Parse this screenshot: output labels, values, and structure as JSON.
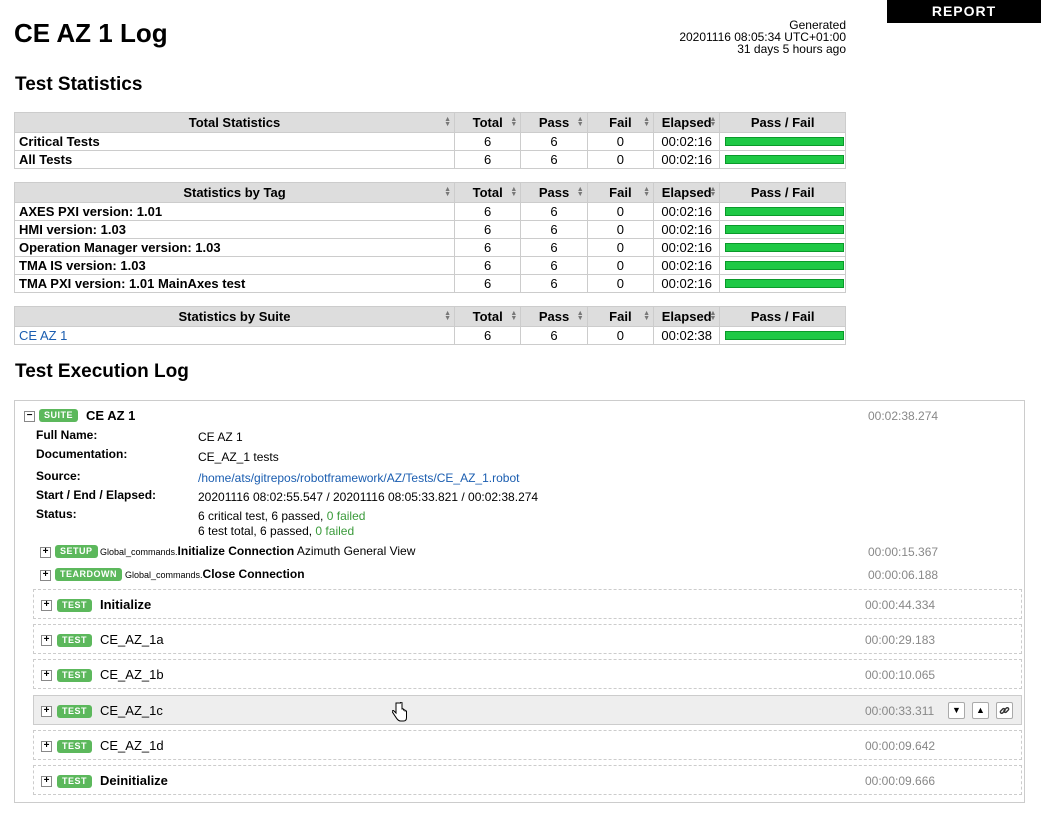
{
  "title": "CE AZ 1 Log",
  "generated": {
    "label": "Generated",
    "timestamp": "20201116 08:05:34 UTC+01:00",
    "ago": "31 days 5 hours ago"
  },
  "report_button": "REPORT",
  "statistics_heading": "Test Statistics",
  "columns": [
    "Total",
    "Pass",
    "Fail",
    "Elapsed",
    "Pass / Fail"
  ],
  "total_stats": {
    "header": "Total Statistics",
    "rows": [
      {
        "name": "Critical Tests",
        "total": "6",
        "pass": "6",
        "fail": "0",
        "elapsed": "00:02:16",
        "pass_ratio": 1.0
      },
      {
        "name": "All Tests",
        "total": "6",
        "pass": "6",
        "fail": "0",
        "elapsed": "00:02:16",
        "pass_ratio": 1.0
      }
    ]
  },
  "tag_stats": {
    "header": "Statistics by Tag",
    "rows": [
      {
        "name": "AXES PXI version: 1.01",
        "total": "6",
        "pass": "6",
        "fail": "0",
        "elapsed": "00:02:16",
        "pass_ratio": 1.0
      },
      {
        "name": "HMI version: 1.03",
        "total": "6",
        "pass": "6",
        "fail": "0",
        "elapsed": "00:02:16",
        "pass_ratio": 1.0
      },
      {
        "name": "Operation Manager version: 1.03",
        "total": "6",
        "pass": "6",
        "fail": "0",
        "elapsed": "00:02:16",
        "pass_ratio": 1.0
      },
      {
        "name": "TMA IS version: 1.03",
        "total": "6",
        "pass": "6",
        "fail": "0",
        "elapsed": "00:02:16",
        "pass_ratio": 1.0
      },
      {
        "name": "TMA PXI version: 1.01 MainAxes test",
        "total": "6",
        "pass": "6",
        "fail": "0",
        "elapsed": "00:02:16",
        "pass_ratio": 1.0
      }
    ]
  },
  "suite_stats": {
    "header": "Statistics by Suite",
    "rows": [
      {
        "name": "CE AZ 1",
        "total": "6",
        "pass": "6",
        "fail": "0",
        "elapsed": "00:02:38",
        "pass_ratio": 1.0
      }
    ]
  },
  "log_heading": "Test Execution Log",
  "suite": {
    "badge": "SUITE",
    "name": "CE AZ 1",
    "elapsed": "00:02:38.274",
    "meta": {
      "full_name_label": "Full Name:",
      "full_name": "CE AZ 1",
      "doc_label": "Documentation:",
      "doc": "CE_AZ_1 tests",
      "source_label": "Source:",
      "source": "/home/ats/gitrepos/robotframework/AZ/Tests/CE_AZ_1.robot",
      "times_label": "Start / End / Elapsed:",
      "times": "20201116 08:02:55.547 / 20201116 08:05:33.821 / 00:02:38.274",
      "status_label": "Status:",
      "status_line1": "6 critical test, 6 passed,",
      "status_line1_fail": "0 failed",
      "status_line2": "6 test total, 6 passed,",
      "status_line2_fail": "0 failed"
    },
    "setup": {
      "badge": "SETUP",
      "lib": "Global_commands.",
      "kw": "Initialize Connection",
      "args": "Azimuth General View",
      "elapsed": "00:00:15.367"
    },
    "teardown": {
      "badge": "TEARDOWN",
      "lib": "Global_commands.",
      "kw": "Close Connection",
      "elapsed": "00:00:06.188"
    },
    "tests": [
      {
        "badge": "TEST",
        "name": "Initialize",
        "elapsed": "00:00:44.334"
      },
      {
        "badge": "TEST",
        "name": "CE_AZ_1a",
        "elapsed": "00:00:29.183"
      },
      {
        "badge": "TEST",
        "name": "CE_AZ_1b",
        "elapsed": "00:00:10.065"
      },
      {
        "badge": "TEST",
        "name": "CE_AZ_1c",
        "elapsed": "00:00:33.311"
      },
      {
        "badge": "TEST",
        "name": "CE_AZ_1d",
        "elapsed": "00:00:09.642"
      },
      {
        "badge": "TEST",
        "name": "Deinitialize",
        "elapsed": "00:00:09.666"
      }
    ]
  },
  "icons": {
    "expand": "plus-icon",
    "collapse": "minus-icon",
    "sort": "sort-icon",
    "expand_all": "chevron-down-icon",
    "collapse_all": "chevron-up-icon",
    "link": "link-icon"
  },
  "colors": {
    "pass": "#1ec945",
    "badge": "#5cb85c",
    "link": "#1a5db0"
  }
}
